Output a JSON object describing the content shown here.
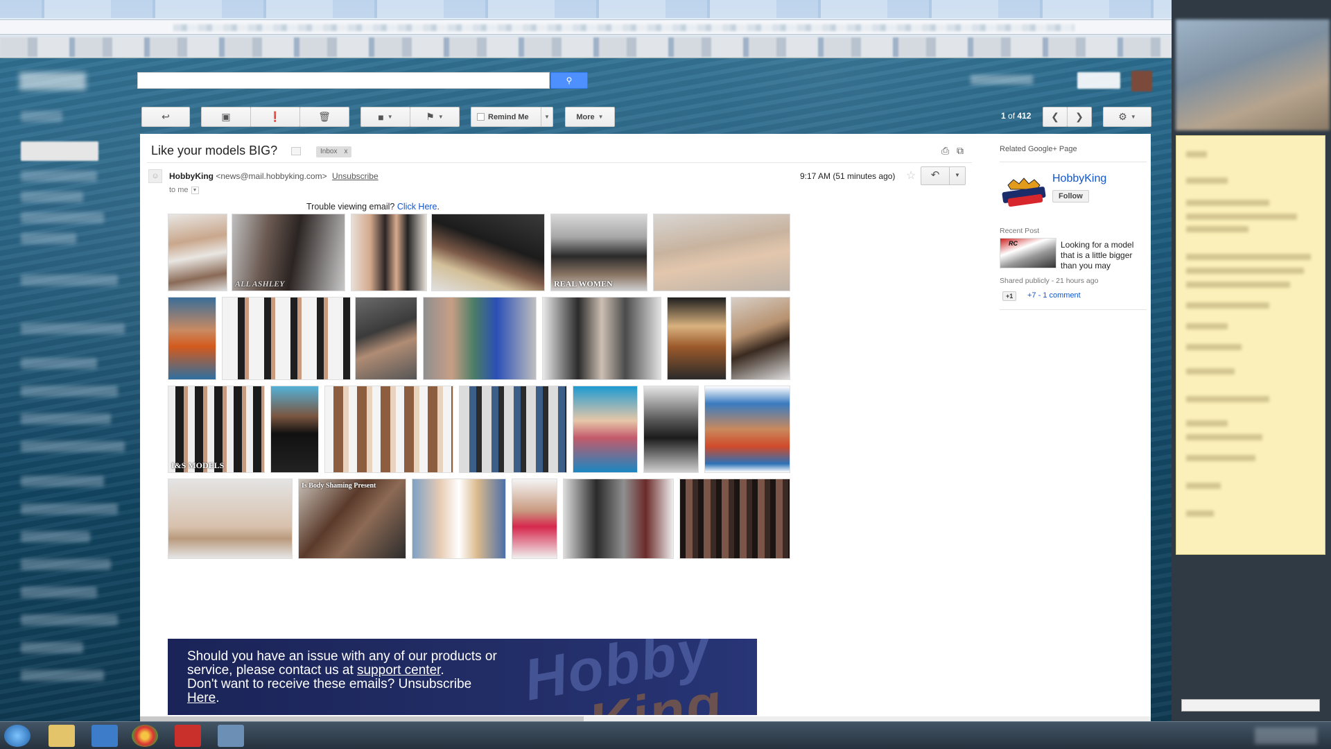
{
  "toolbar": {
    "remind_label": "Remind Me",
    "more_label": "More",
    "pager_current": "1",
    "pager_sep": " of ",
    "pager_total": "412"
  },
  "message": {
    "subject": "Like your models BIG?",
    "label": "Inbox",
    "label_remove": "x",
    "sender_name": "HobbyKing",
    "sender_email": "<news@mail.hobbyking.com>",
    "unsubscribe": "Unsubscribe",
    "to": "to me",
    "time": "9:17 AM (51 minutes ago)",
    "trouble_text": "Trouble viewing email?",
    "trouble_link": "Click Here",
    "trouble_end": "."
  },
  "photos": [
    {
      "label": ""
    },
    {
      "label": "ALL ASHLEY"
    },
    {
      "label": ""
    },
    {
      "label": ""
    },
    {
      "label": "REAL WOMEN"
    },
    {
      "label": ""
    },
    {
      "label": ""
    },
    {
      "label": ""
    },
    {
      "label": ""
    },
    {
      "label": ""
    },
    {
      "label": ""
    },
    {
      "label": ""
    },
    {
      "label": ""
    },
    {
      "label": "I&S MODELS"
    },
    {
      "label": ""
    },
    {
      "label": ""
    },
    {
      "label": ""
    },
    {
      "label": ""
    },
    {
      "label": ""
    },
    {
      "label": ""
    },
    {
      "label": ""
    },
    {
      "label": "Is Body Shaming Present"
    },
    {
      "label": ""
    },
    {
      "label": ""
    },
    {
      "label": ""
    },
    {
      "label": ""
    }
  ],
  "footer": {
    "line1": "Should you have an issue with any of our products or service, please contact us at ",
    "support_link": "support center",
    "line1_end": ".",
    "line2": "Don't want to receive these emails? Unsubscribe ",
    "here_link": "Here",
    "line2_end": ".",
    "logo_top": "Hobby",
    "logo_bottom": "King"
  },
  "related": {
    "title": "Related Google+ Page",
    "page_name": "HobbyKing",
    "follow": "Follow",
    "recent_label": "Recent Post",
    "thumb_text": "RC",
    "recent_text": "Looking for a model that is a little bigger than you may",
    "shared": "Shared publicly - 21 hours ago",
    "plus_one": "+1",
    "plus_count": "+7",
    "comments": " - 1 comment"
  },
  "colors": {
    "link": "#1155cc",
    "search_button": "#4d90fe",
    "footer_banner": "#1a2458"
  }
}
